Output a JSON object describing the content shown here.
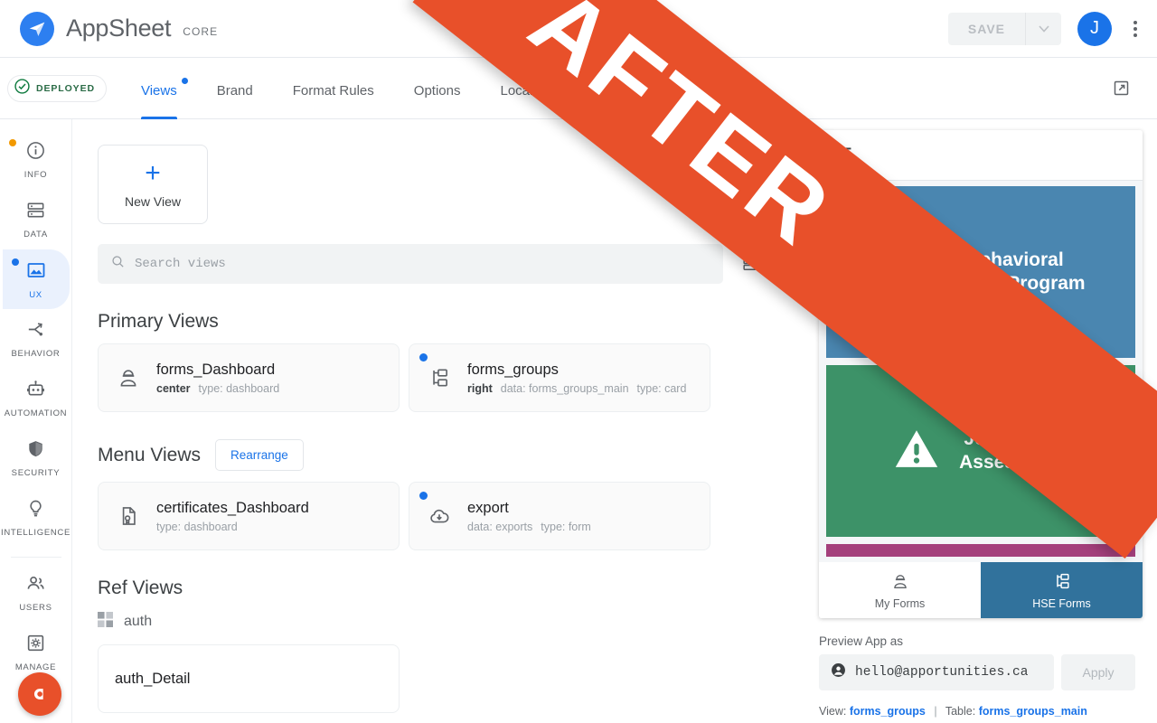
{
  "topbar": {
    "brand": "AppSheet",
    "edition": "CORE",
    "save_label": "SAVE",
    "avatar_initial": "J",
    "logo_icon": "appsheet-paper-plane-icon",
    "caret_icon": "chevron-down-icon",
    "kebab_icon": "more-vert-icon"
  },
  "tabbar": {
    "deployed_label": "DEPLOYED",
    "deployed_icon": "check-circle-icon",
    "ext_link_icon": "open-in-new-icon",
    "tabs": [
      {
        "label": "Views",
        "active": true,
        "dot": true
      },
      {
        "label": "Brand",
        "active": false,
        "dot": false
      },
      {
        "label": "Format Rules",
        "active": false,
        "dot": false
      },
      {
        "label": "Options",
        "active": false,
        "dot": false
      },
      {
        "label": "Localize",
        "active": false,
        "dot": false
      }
    ]
  },
  "rail": {
    "items": [
      {
        "label": "INFO",
        "icon": "info-icon",
        "active": false,
        "dot": "#f29900"
      },
      {
        "label": "DATA",
        "icon": "database-icon",
        "active": false,
        "dot": ""
      },
      {
        "label": "UX",
        "icon": "image-icon",
        "active": true,
        "dot": "#1a73e8"
      },
      {
        "label": "BEHAVIOR",
        "icon": "branch-arrow-icon",
        "active": false,
        "dot": ""
      },
      {
        "label": "AUTOMATION",
        "icon": "robot-icon",
        "active": false,
        "dot": ""
      },
      {
        "label": "SECURITY",
        "icon": "shield-icon",
        "active": false,
        "dot": ""
      },
      {
        "label": "INTELLIGENCE",
        "icon": "lightbulb-icon",
        "active": false,
        "dot": ""
      },
      {
        "label": "USERS",
        "icon": "people-icon",
        "active": false,
        "dot": ""
      },
      {
        "label": "MANAGE",
        "icon": "gear-square-icon",
        "active": false,
        "dot": ""
      }
    ],
    "fab_icon": "appsheet-assistant-icon"
  },
  "main": {
    "new_view_label": "New View",
    "new_view_icon": "plus-icon",
    "search_placeholder": "Search views",
    "search_value": "",
    "search_icon": "search-icon",
    "layout_toggle_icon": "list-layout-icon",
    "scroll_arrow_icon": "chevron-right-icon",
    "sections": [
      {
        "title": "Primary Views",
        "has_rearrange": false,
        "rearrange_label": "",
        "cards": [
          {
            "name": "forms_Dashboard",
            "icon": "hardhat-person-icon",
            "dot": false,
            "position": "center",
            "data": "",
            "type": "type: dashboard"
          },
          {
            "name": "forms_groups",
            "icon": "folder-tree-icon",
            "dot": true,
            "position": "right",
            "data": "data: forms_groups_main",
            "type": "type: card"
          }
        ]
      },
      {
        "title": "Menu Views",
        "has_rearrange": true,
        "rearrange_label": "Rearrange",
        "cards": [
          {
            "name": "certificates_Dashboard",
            "icon": "document-badge-icon",
            "dot": false,
            "position": "",
            "data": "",
            "type": "type: dashboard"
          },
          {
            "name": "export",
            "icon": "cloud-download-icon",
            "dot": true,
            "position": "",
            "data": "data: exports",
            "type": "type: form"
          }
        ]
      }
    ],
    "ref_section": {
      "title": "Ref Views",
      "group_name": "auth",
      "group_icon": "grid-icon",
      "card_name": "auth_Detail"
    }
  },
  "preview": {
    "phone_menu_icon": "sort-lines-icon",
    "tiles": [
      {
        "title": "Behavioral\nSafety Program",
        "color": "#4a86b0",
        "icon": "hardhat-person-icon"
      },
      {
        "title": "Job Hazard\nAssessment",
        "color": "#3d9268",
        "icon": "warning-triangle-icon"
      }
    ],
    "strip_color": "#a4407c",
    "nav": [
      {
        "label": "My Forms",
        "icon": "hardhat-person-icon",
        "active": false
      },
      {
        "label": "HSE Forms",
        "icon": "folder-tree-icon",
        "active": true
      }
    ],
    "preview_as_label": "Preview App as",
    "email_value": "hello@apportunities.ca",
    "email_icon": "account-circle-icon",
    "apply_label": "Apply",
    "footer": {
      "view_prefix": "View:",
      "view_name": "forms_groups",
      "separator": "|",
      "table_prefix": "Table:",
      "table_name": "forms_groups_main"
    }
  },
  "banner": {
    "text": "AFTER",
    "color": "#e8502a"
  }
}
